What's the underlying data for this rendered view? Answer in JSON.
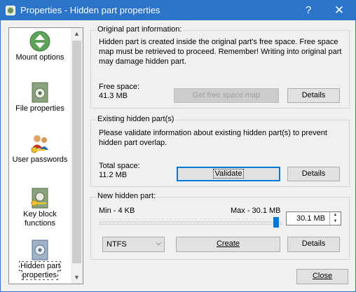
{
  "window": {
    "title": "Properties - Hidden part properties",
    "help_label": "?",
    "close_glyph": "✕"
  },
  "sidebar": {
    "items": [
      {
        "label": "Mount options",
        "icon": "mount-eject-icon"
      },
      {
        "label": "File properties",
        "icon": "file-safe-icon"
      },
      {
        "label": "User passwords",
        "icon": "users-key-icon"
      },
      {
        "label": "Key block functions",
        "icon": "key-block-icon"
      },
      {
        "label": "Hidden part properties",
        "icon": "hidden-safe-icon",
        "selected": true
      }
    ]
  },
  "original": {
    "title": "Original part information:",
    "description": "Hidden part is created inside the original part's free space. Free space map must be retrieved to proceed. Remember! Writing into original part may damage hidden part.",
    "free_space_label": "Free space:",
    "free_space_value": "41.3 MB",
    "get_map_button": "Get free space map",
    "details_button": "Details"
  },
  "existing": {
    "title": "Existing hidden part(s)",
    "description": "Please validate information about existing hidden part(s) to prevent hidden part overlap.",
    "total_space_label": "Total space:",
    "total_space_value": "11.2 MB",
    "validate_button": "Validate",
    "details_button": "Details"
  },
  "new_part": {
    "title": "New hidden part:",
    "min_label": "Min - 4 KB",
    "max_label": "Max - 30.1 MB",
    "size_value": "30.1 MB",
    "slider_fraction": 1.0,
    "filesystem_value": "NTFS",
    "create_button": "Create",
    "details_button": "Details"
  },
  "footer": {
    "close_button": "Close"
  },
  "colors": {
    "titlebar": "#2b74c9",
    "accent": "#0078d7"
  }
}
